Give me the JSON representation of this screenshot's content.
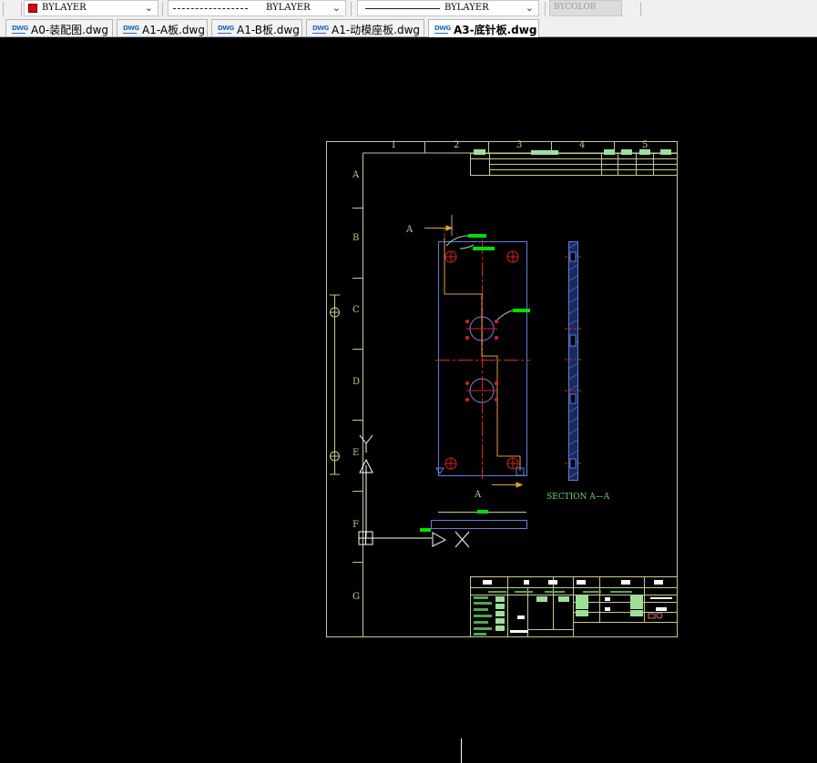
{
  "toolbar": {
    "color_value": "BYLAYER",
    "color_swatch": "#e00000",
    "linetype_value": "BYLAYER",
    "lineweight_value": "BYLAYER",
    "plotstyle_value": "BYCOLOR"
  },
  "tabs": [
    {
      "label": "A0-装配图.dwg",
      "icon": "autocad-file-icon",
      "active": false
    },
    {
      "label": "A1-A板.dwg",
      "icon": "autocad-file-icon",
      "active": false
    },
    {
      "label": "A1-B板.dwg",
      "icon": "autocad-file-icon",
      "active": false
    },
    {
      "label": "A1-动模座板.dwg",
      "icon": "autocad-file-icon",
      "active": false
    },
    {
      "label": "A3-底针板.dwg",
      "icon": "autocad-file-icon",
      "active": true
    }
  ],
  "drawing": {
    "column_labels": [
      "1",
      "2",
      "3",
      "4",
      "5"
    ],
    "row_labels": [
      "A",
      "B",
      "C",
      "D",
      "E",
      "F",
      "G"
    ],
    "section_marker_top": "A",
    "section_marker_bottom": "A",
    "section_title": "SECTION A—A"
  },
  "colors": {
    "frame": "#c9c98a",
    "part_outline": "#5b7fe0",
    "centerline": "#e02020",
    "annotation": "#00e000",
    "leader": "#e0a040",
    "background": "#000000"
  },
  "ucs_icon": {
    "x_axis": "X",
    "y_axis": "Y"
  }
}
